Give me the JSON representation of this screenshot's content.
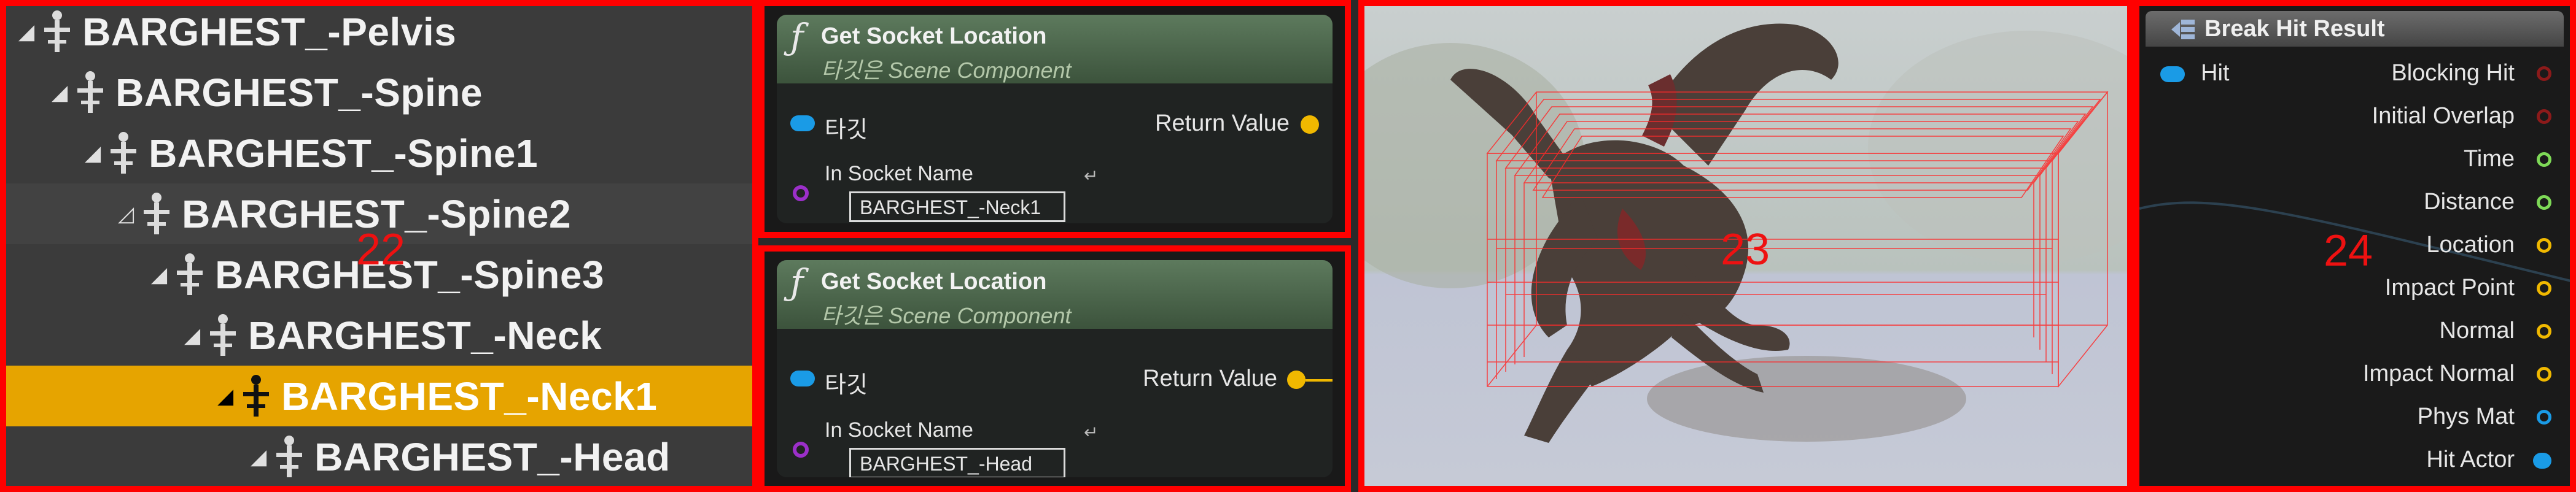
{
  "skeleton_tree": {
    "marker": "22",
    "bones": [
      {
        "label": "BARGHEST_-Pelvis",
        "depth": 0,
        "state": "normal"
      },
      {
        "label": "BARGHEST_-Spine",
        "depth": 1,
        "state": "normal"
      },
      {
        "label": "BARGHEST_-Spine1",
        "depth": 2,
        "state": "normal"
      },
      {
        "label": "BARGHEST_-Spine2",
        "depth": 3,
        "state": "hover"
      },
      {
        "label": "BARGHEST_-Spine3",
        "depth": 4,
        "state": "normal"
      },
      {
        "label": "BARGHEST_-Neck",
        "depth": 5,
        "state": "normal"
      },
      {
        "label": "BARGHEST_-Neck1",
        "depth": 6,
        "state": "selected"
      },
      {
        "label": "BARGHEST_-Head",
        "depth": 7,
        "state": "normal"
      }
    ]
  },
  "socket_nodes": [
    {
      "title": "Get Socket Location",
      "subtitle": "타깃은 Scene Component",
      "target_label": "타깃",
      "return_label": "Return Value",
      "socket_name_label": "In Socket Name",
      "socket_value": "BARGHEST_-Neck1"
    },
    {
      "title": "Get Socket Location",
      "subtitle": "타깃은 Scene Component",
      "target_label": "타깃",
      "return_label": "Return Value",
      "socket_name_label": "In Socket Name",
      "socket_value": "BARGHEST_-Head"
    }
  ],
  "viewport": {
    "marker": "23"
  },
  "break_hit": {
    "title": "Break Hit Result",
    "marker": "24",
    "input_label": "Hit",
    "outputs": [
      {
        "label": "Blocking Hit",
        "pin": "bool-icon"
      },
      {
        "label": "Initial Overlap",
        "pin": "bool-icon"
      },
      {
        "label": "Time",
        "pin": "float-icon"
      },
      {
        "label": "Distance",
        "pin": "float-icon"
      },
      {
        "label": "Location",
        "pin": "vector-icon"
      },
      {
        "label": "Impact Point",
        "pin": "vector-icon"
      },
      {
        "label": "Normal",
        "pin": "vector-icon"
      },
      {
        "label": "Impact Normal",
        "pin": "vector-icon"
      },
      {
        "label": "Phys Mat",
        "pin": "object-icon"
      },
      {
        "label": "Hit Actor",
        "pin": "object-icon"
      }
    ]
  },
  "colors": {
    "highlight_border": "#ff0000",
    "selected_row": "#e6a400",
    "bool_pin": "#8c1a1a",
    "float_pin": "#7ed957",
    "vector_pin": "#f0b800",
    "object_pin": "#1a9be6",
    "debug_box": "#ff2a2a"
  }
}
